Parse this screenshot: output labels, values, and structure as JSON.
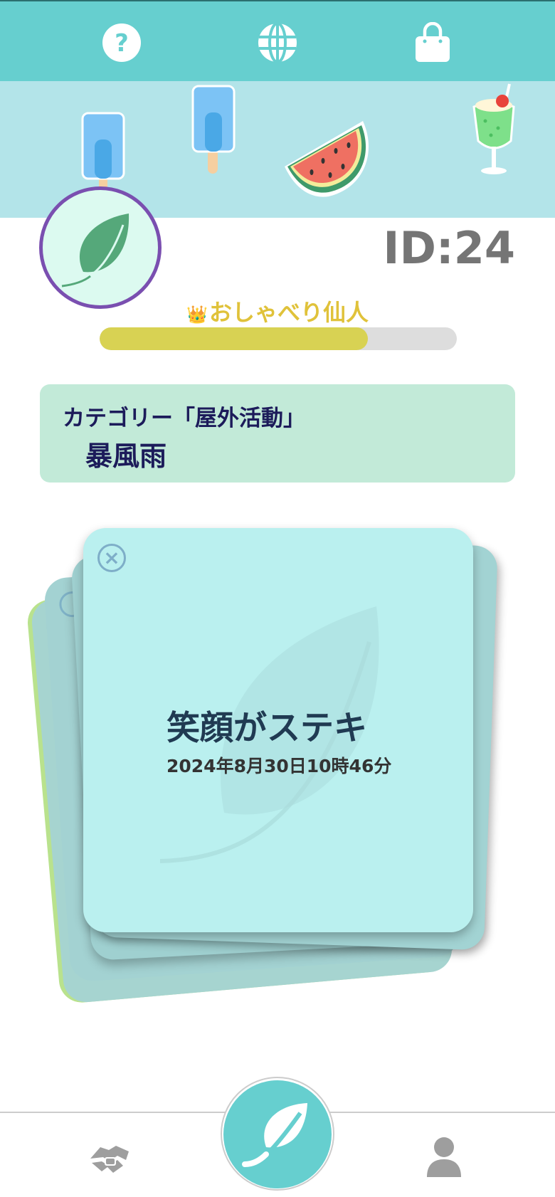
{
  "header": {
    "buttons": [
      {
        "icon": "help-icon",
        "label": "?"
      },
      {
        "icon": "globe-icon"
      },
      {
        "icon": "shopping-bag-icon"
      }
    ],
    "accent_color": "#66cfcf",
    "banner_color": "#b3e4e9"
  },
  "banner": {
    "decorations": [
      "popsicle-icon",
      "popsicle-icon",
      "watermelon-icon",
      "melon-soda-icon"
    ]
  },
  "profile": {
    "avatar_icon": "leaf-icon",
    "id_text": "ID:24",
    "rank_crown": "👑",
    "rank_title": "おしゃべり仙人",
    "progress": 0.75
  },
  "category": {
    "label": "カテゴリー「屋外活動」",
    "value": "暴風雨",
    "background": "#c2ead8"
  },
  "card": {
    "close_symbol": "×",
    "title": "笑顔がステキ",
    "date": "2024年8月30日10時46分",
    "background": "#baf0ef"
  },
  "bottom_nav": {
    "items": [
      {
        "icon": "handshake-icon"
      },
      {
        "icon": "leaf-fab-icon"
      },
      {
        "icon": "user-icon"
      }
    ]
  }
}
